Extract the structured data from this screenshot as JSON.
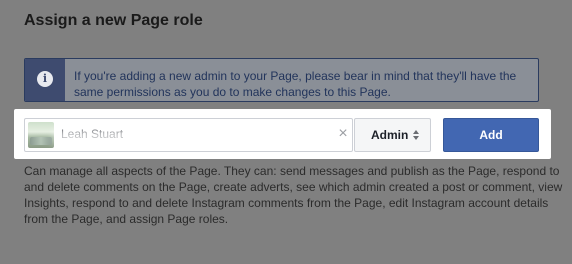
{
  "dialog": {
    "title": "Assign a new Page role"
  },
  "info_banner": {
    "icon": "info-icon",
    "text": "If you're adding a new admin to your Page, please bear in mind that they'll have the same permissions as you do to make changes to this Page."
  },
  "form": {
    "name_input": {
      "value": "Leah Stuart",
      "clear_icon": "close-icon"
    },
    "role_select": {
      "selected": "Admin",
      "icon": "sort-arrows-icon"
    },
    "add_button": {
      "label": "Add"
    }
  },
  "role_description": {
    "text": "Can manage all aspects of the Page. They can: send messages and publish as the Page, respond to and delete comments on the Page, create adverts, see which admin created a post or comment, view Insights, respond to and delete Instagram comments from the Page, edit Instagram account details from the Page, and assign Page roles."
  },
  "colors": {
    "overlay_bg": "#808080",
    "info_bg": "#8a8f97",
    "info_icon_bg": "#3e4b6f",
    "primary_button": "#4267b2",
    "highlight_panel": "#ffffff"
  }
}
